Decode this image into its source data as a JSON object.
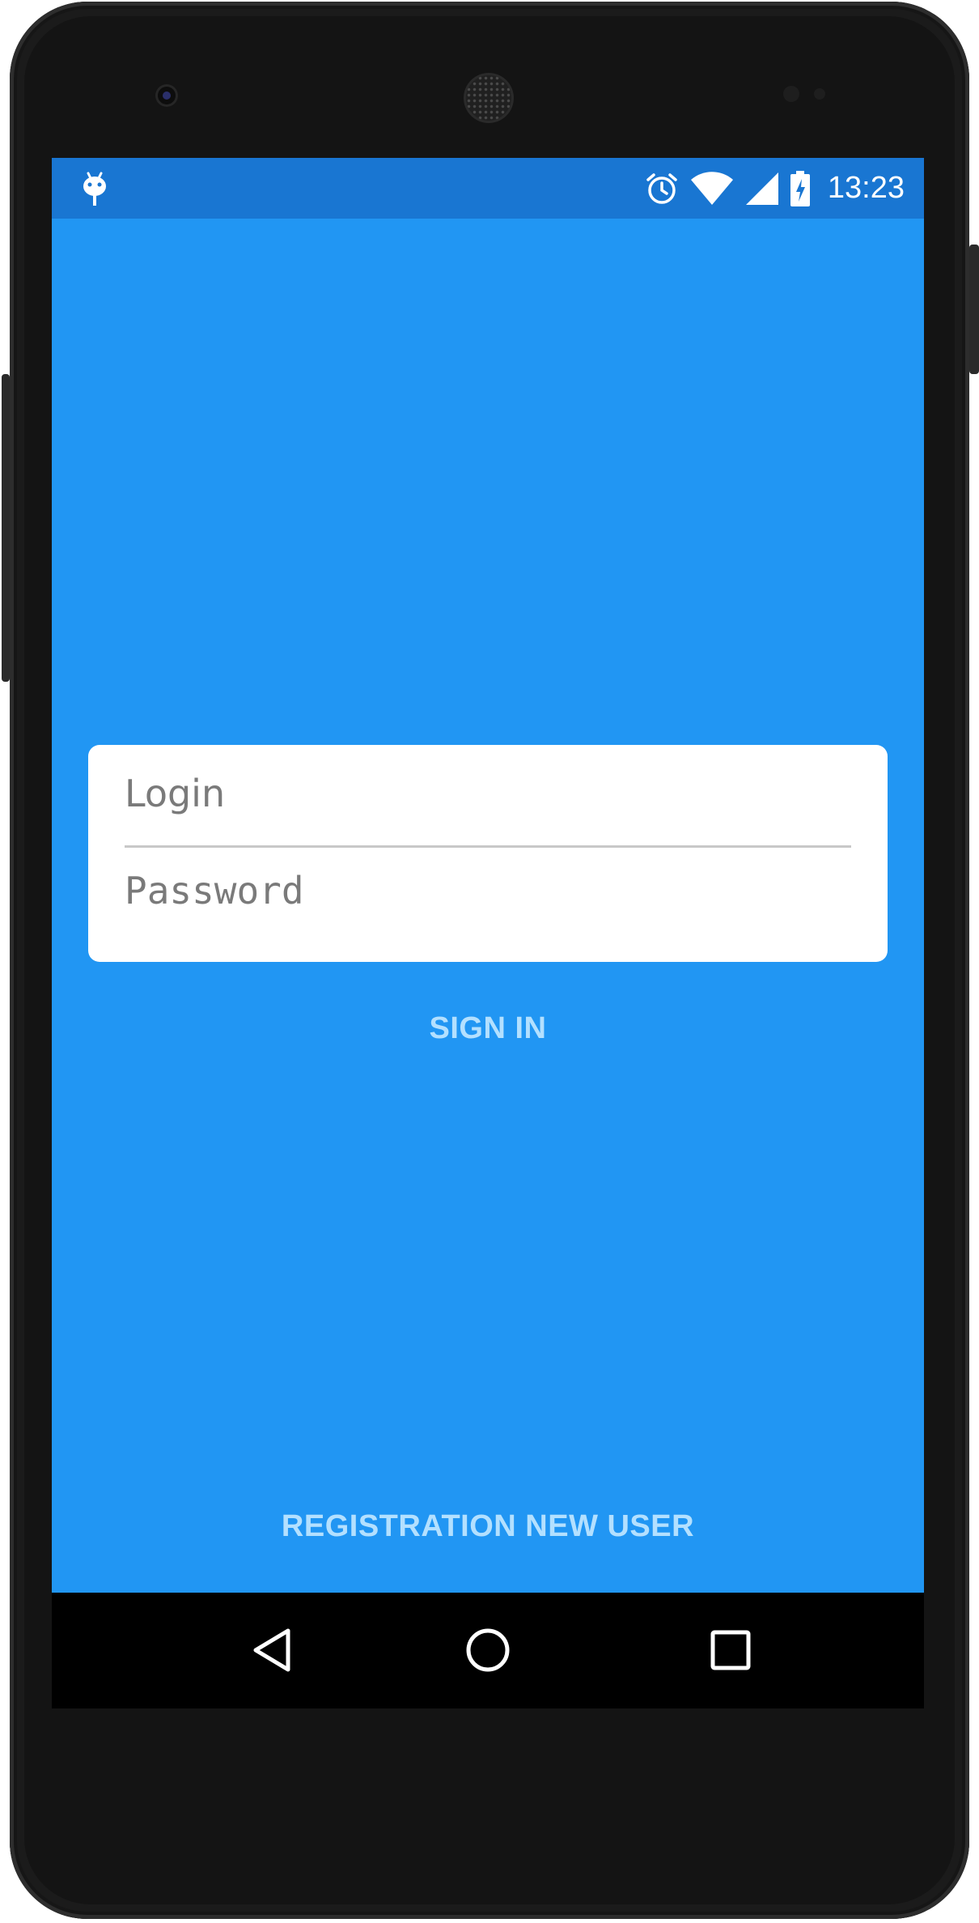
{
  "status_bar": {
    "time": "13:23",
    "icons": [
      "android-debug-icon",
      "alarm-icon",
      "wifi-icon",
      "signal-icon",
      "battery-charging-icon"
    ]
  },
  "login_form": {
    "login_placeholder": "Login",
    "password_placeholder": "Password"
  },
  "actions": {
    "sign_in_label": "SIGN IN",
    "register_label": "REGISTRATION NEW USER"
  },
  "nav_bar": {
    "icons": [
      "back-icon",
      "home-icon",
      "recent-apps-icon"
    ]
  },
  "colors": {
    "screen_background": "#2196f3",
    "status_bar_background": "#1976d2",
    "button_text": "#b3e0ff",
    "card_background": "#ffffff"
  }
}
